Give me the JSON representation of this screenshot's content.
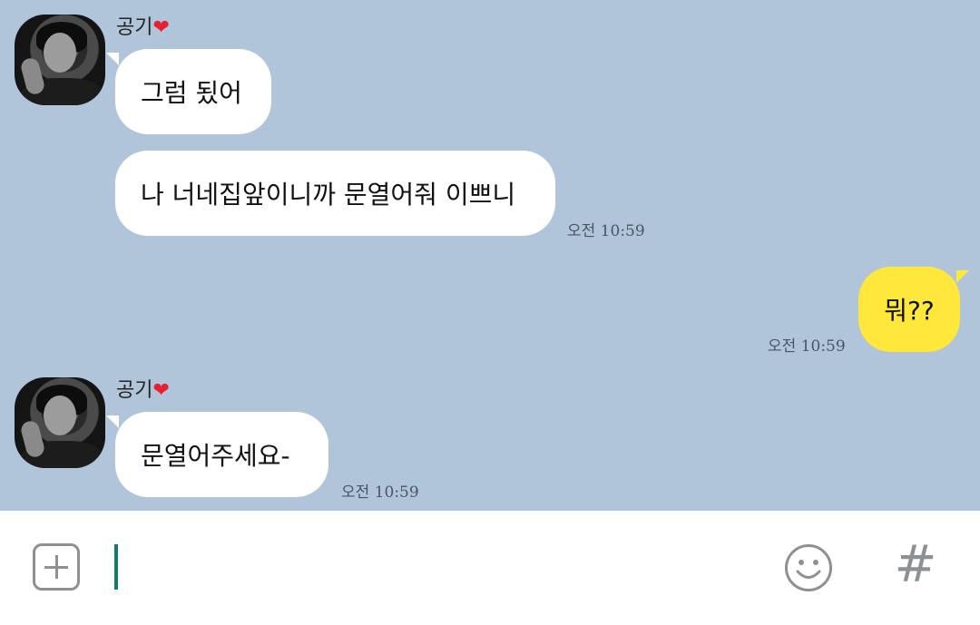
{
  "messages": [
    {
      "sender": "공기",
      "sender_heart": "❤",
      "text": "그럼 됬어"
    },
    {
      "text": "나 너네집앞이니까 문열어줘 이쁘니",
      "time": "오전 10:59"
    },
    {
      "text": "뭐??",
      "time": "오전 10:59",
      "mine": true
    },
    {
      "sender": "공기",
      "sender_heart": "❤",
      "text": "문열어주세요-",
      "time": "오전 10:59"
    }
  ],
  "input_bar": {
    "plus_icon": "plus-icon",
    "emoji_icon": "smiley-icon",
    "hash_label": "#"
  },
  "colors": {
    "chat_background": "#b1c5da",
    "incoming_bubble": "#ffffff",
    "outgoing_bubble": "#ffe83b",
    "cursor": "#147a6e",
    "heart": "#e8202f"
  }
}
